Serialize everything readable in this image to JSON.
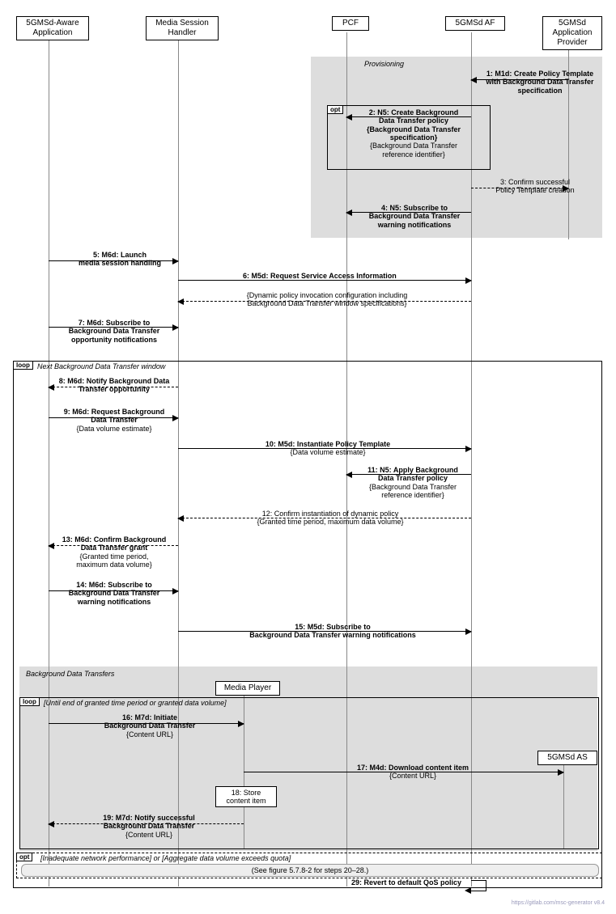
{
  "participants": {
    "app": "5GMSd-Aware\nApplication",
    "msh": "Media Session\nHandler",
    "pcf": "PCF",
    "af": "5GMSd AF",
    "ap": "5GMSd\nApplication\nProvider",
    "mp": "Media Player",
    "as": "5GMSd AS"
  },
  "regions": {
    "provisioning": "Provisioning",
    "bdt": "Background Data Transfers"
  },
  "frames": {
    "opt1": "opt",
    "loop1": "loop",
    "loop1_title": "Next Background Data Transfer window",
    "loop2": "loop",
    "loop2_title": "[Until end of granted time period or granted data volume]",
    "opt2": "opt",
    "opt2_title": "[Inadequate network performance] or [Aggregate data volume exceeds quota]"
  },
  "messages": {
    "m1_t": "1: M1d: Create Policy Template",
    "m1_s1": "with Background Data Transfer",
    "m1_s2": "specification",
    "m2_t": "2: N5: Create Background",
    "m2_s1": "Data Transfer policy",
    "m2_s2": "{Background Data Transfer",
    "m2_s3": "specification}",
    "m2_s4": "{Background Data Transfer",
    "m2_s5": "reference identifier}",
    "m3_t": "3: Confirm successful",
    "m3_s1": "Policy Template creation",
    "m4_t": "4: N5: Subscribe to",
    "m4_s1": "Background Data Transfer",
    "m4_s2": "warning notifications",
    "m5_t": "5: M6d: Launch",
    "m5_s1": "media session handling",
    "m6_t": "6: M5d: Request Service Access Information",
    "m6_s1": "{Dynamic policy invocation configuration including",
    "m6_s2": "Background Data Transfer window specifications}",
    "m7_t": "7: M6d: Subscribe to",
    "m7_s1": "Background Data Transfer",
    "m7_s2": "opportunity notifications",
    "m8_t": "8: M6d: Notify Background Data",
    "m8_s1": "Transfer opportunity",
    "m9_t": "9: M6d: Request Background",
    "m9_s1": "Data Transfer",
    "m9_s2": "{Data volume estimate}",
    "m10_t": "10: M5d: Instantiate Policy Template",
    "m10_s1": "{Data volume estimate}",
    "m11_t": "11: N5: Apply Background",
    "m11_s1": "Data Transfer policy",
    "m11_s2": "{Background Data Transfer",
    "m11_s3": "reference identifier}",
    "m12_t": "12: Confirm instantiation of dynamic policy",
    "m12_s1": "{Granted time period, maximum data volume}",
    "m13_t": "13: M6d: Confirm Background",
    "m13_s1": "Data Transfer grant",
    "m13_s2": "{Granted time period,",
    "m13_s3": "maximum data volume}",
    "m14_t": "14: M6d: Subscribe to",
    "m14_s1": "Background Data Transfer",
    "m14_s2": "warning notifications",
    "m15_t": "15: M5d: Subscribe to",
    "m15_s1": "Background Data Transfer warning notifications",
    "m16_t": "16: M7d: Initiate",
    "m16_s1": "Background Data Transfer",
    "m16_s2": "{Content URL}",
    "m17_t": "17: M4d: Download content item",
    "m17_s1": "{Content URL}",
    "m18_t": "18: Store",
    "m18_s": "content item",
    "m19_t": "19: M7d: Notify successful",
    "m19_s1": "Background Data Transfer",
    "m19_s2": "{Content URL}",
    "ref": "(See figure 5.7.8-2 for steps 20–28.)",
    "m29_t": "29: Revert to default QoS policy"
  },
  "footer": "https://gitlab.com/msc-generator v8.4"
}
